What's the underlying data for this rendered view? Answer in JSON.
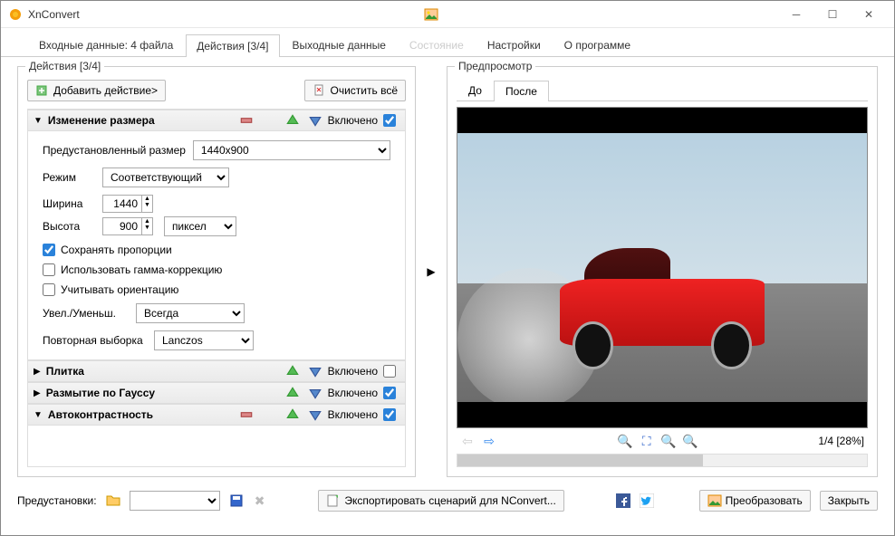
{
  "window": {
    "title": "XnConvert"
  },
  "tabs": {
    "input": "Входные данные: 4 файла",
    "actions": "Действия [3/4]",
    "output": "Выходные данные",
    "status": "Состояние",
    "settings": "Настройки",
    "about": "О программе"
  },
  "left": {
    "panel_title": "Действия [3/4]",
    "add_action": "Добавить действие>",
    "clear_all": "Очистить всё",
    "enabled_label": "Включено",
    "resize": {
      "title": "Изменение размера",
      "preset_label": "Предустановленный размер",
      "preset_value": "1440x900",
      "mode_label": "Режим",
      "mode_value": "Соответствующий",
      "width_label": "Ширина",
      "width_value": "1440",
      "height_label": "Высота",
      "height_value": "900",
      "unit": "пиксел",
      "keep_aspect": "Сохранять пропорции",
      "gamma": "Использовать гамма-коррекцию",
      "orientation": "Учитывать ориентацию",
      "scale_label": "Увел./Уменьш.",
      "scale_value": "Всегда",
      "resample_label": "Повторная выборка",
      "resample_value": "Lanczos"
    },
    "tile": "Плитка",
    "gauss": "Размытие по Гауссу",
    "autocontrast": "Автоконтрастность"
  },
  "right": {
    "panel_title": "Предпросмотр",
    "before": "До",
    "after": "После",
    "counter": "1/4 [28%]"
  },
  "footer": {
    "presets": "Предустановки:",
    "export": "Экспортировать сценарий для NConvert...",
    "convert": "Преобразовать",
    "close": "Закрыть"
  }
}
